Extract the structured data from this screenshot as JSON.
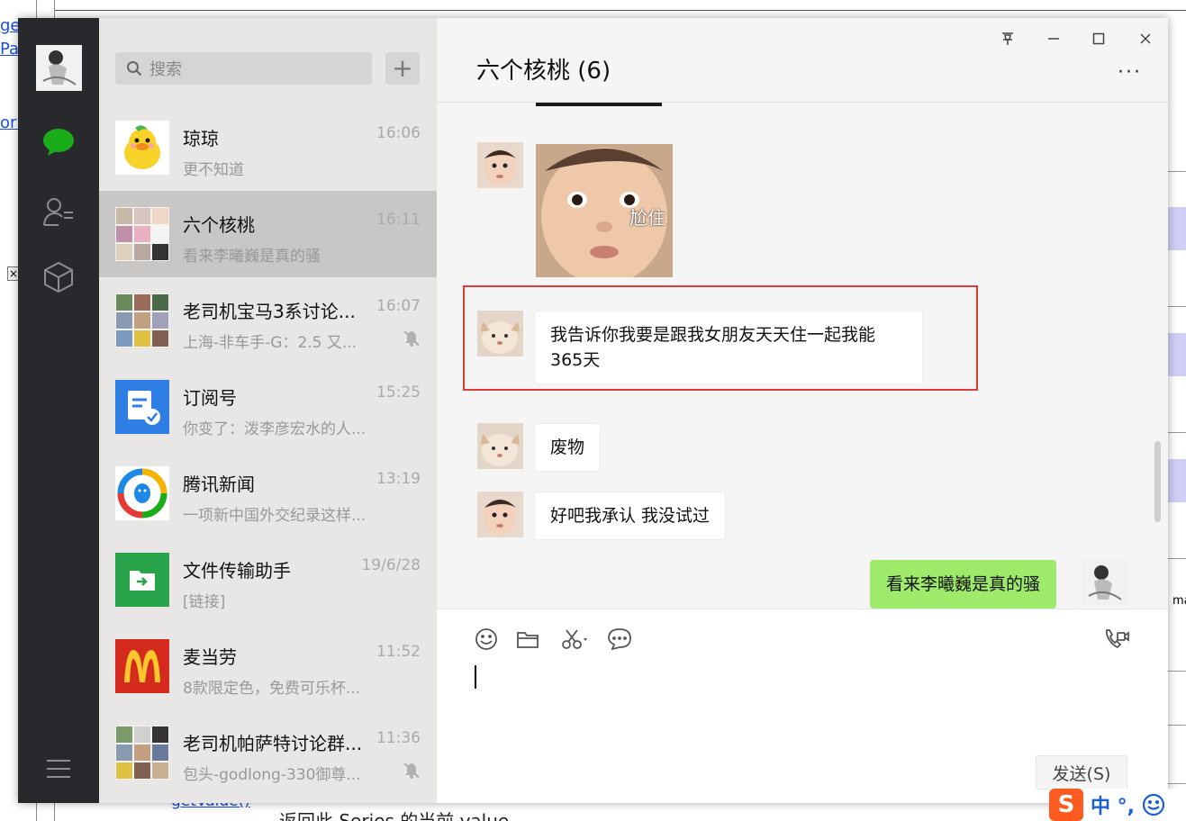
{
  "window": {
    "title": "六个核桃 (6)",
    "more_label": "···",
    "pin_label": "pin",
    "minimize_label": "minimize",
    "maximize_label": "maximize",
    "close_label": "close"
  },
  "search": {
    "placeholder": "搜索",
    "add_label": "+"
  },
  "conversations": [
    {
      "name": "琼琼",
      "time": "16:06",
      "preview": "更不知道",
      "muted": false,
      "active": false
    },
    {
      "name": "六个核桃",
      "time": "16:11",
      "preview": "看来李曦巍是真的骚",
      "muted": false,
      "active": true
    },
    {
      "name": "老司机宝马3系讨论...",
      "time": "16:07",
      "preview": "上海-非车手-G：2.5 又...",
      "muted": true,
      "active": false
    },
    {
      "name": "订阅号",
      "time": "15:25",
      "preview": "你变了：泼李彦宏水的人...",
      "muted": false,
      "active": false
    },
    {
      "name": "腾讯新闻",
      "time": "13:19",
      "preview": "一项新中国外交纪录这样...",
      "muted": false,
      "active": false
    },
    {
      "name": "文件传输助手",
      "time": "19/6/28",
      "preview": "[链接]",
      "muted": false,
      "active": false
    },
    {
      "name": "麦当劳",
      "time": "11:52",
      "preview": "8款限定色，免费可乐杯...",
      "muted": false,
      "active": false
    },
    {
      "name": "老司机帕萨特讨论群...",
      "time": "11:36",
      "preview": "包头-godlong-330御尊...",
      "muted": true,
      "active": false
    }
  ],
  "messages": {
    "sticker_caption": "尬住",
    "m1": "我告诉你我要是跟我女朋友天天住一起我能365天",
    "m2": "废物",
    "m3": "好吧我承认 我没试过",
    "m4": "看来李曦巍是真的骚"
  },
  "composer": {
    "send_label": "发送(S)"
  },
  "ime": {
    "mode": "中 °,",
    "logo": "S"
  },
  "background_doc": {
    "link_1": "ge",
    "link_2": "Pa",
    "link_3": "orF",
    "close_mark": "×",
    "right_text": "ma",
    "bottom_text": "返回此 Series 的当前 value",
    "bottom_link": "getValue()"
  },
  "colors": {
    "nav_bg": "#28292c",
    "list_bg": "#e8e7e6",
    "active_item": "#c8c7c6",
    "chat_bg": "#f5f5f5",
    "my_bubble": "#9eea6a",
    "highlight_border": "#e03a3a",
    "wechat_green": "#1aad19"
  }
}
